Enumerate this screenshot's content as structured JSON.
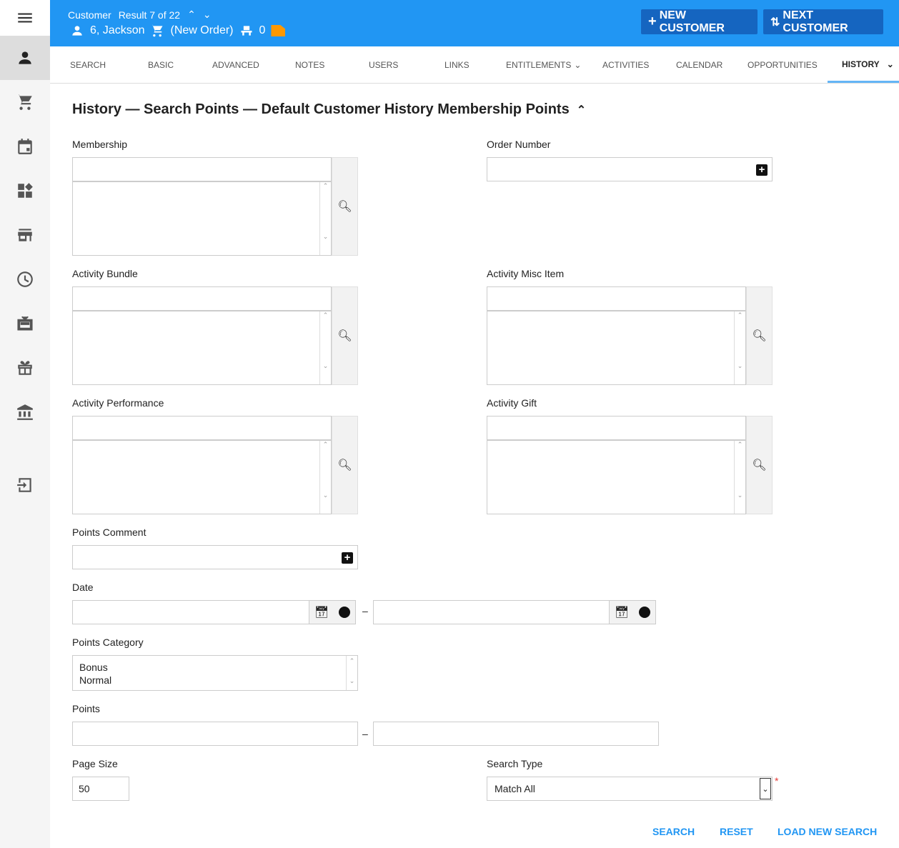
{
  "header": {
    "context": "Customer",
    "result": "Result 7 of 22",
    "customer": "6, Jackson",
    "order": "(New Order)",
    "seats": "0",
    "new_customer": "NEW CUSTOMER",
    "next_customer": "NEXT CUSTOMER",
    "bg": "#2196f3"
  },
  "tabs": [
    "SEARCH",
    "BASIC",
    "ADVANCED",
    "NOTES",
    "USERS",
    "LINKS",
    "ENTITLEMENTS",
    "ACTIVITIES",
    "CALENDAR",
    "OPPORTUNITIES",
    "HISTORY"
  ],
  "title": "History — Search Points — Default Customer History Membership Points",
  "form": {
    "membership": "Membership",
    "order_number": "Order Number",
    "activity_bundle": "Activity Bundle",
    "activity_misc": "Activity Misc Item",
    "activity_performance": "Activity Performance",
    "activity_gift": "Activity Gift",
    "points_comment": "Points Comment",
    "date": "Date",
    "dash": "–",
    "points_category": "Points Category",
    "categories": [
      "Bonus",
      "Normal"
    ],
    "points": "Points",
    "page_size": "Page Size",
    "page_size_value": "50",
    "search_type": "Search Type",
    "search_type_value": "Match All",
    "required": "*"
  },
  "actions": {
    "search": "SEARCH",
    "reset": "RESET",
    "load": "LOAD NEW SEARCH"
  }
}
